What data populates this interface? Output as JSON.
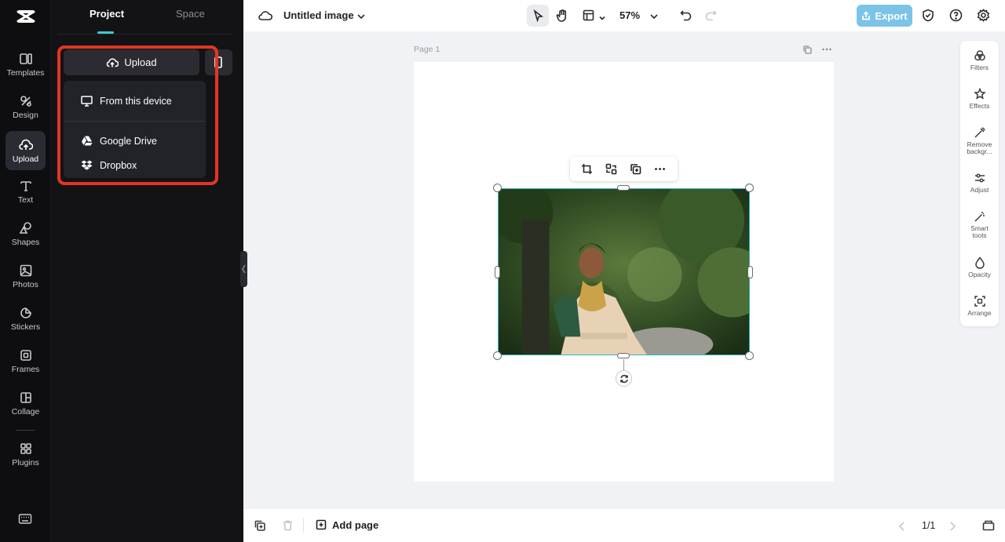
{
  "rail": {
    "items": [
      {
        "label": "Templates",
        "icon": "templates-icon"
      },
      {
        "label": "Design",
        "icon": "design-icon"
      },
      {
        "label": "Upload",
        "icon": "upload-cloud-icon",
        "active": true
      },
      {
        "label": "Text",
        "icon": "text-icon"
      },
      {
        "label": "Shapes",
        "icon": "shapes-icon"
      },
      {
        "label": "Photos",
        "icon": "photos-icon"
      },
      {
        "label": "Stickers",
        "icon": "stickers-icon"
      },
      {
        "label": "Frames",
        "icon": "frames-icon"
      },
      {
        "label": "Collage",
        "icon": "collage-icon"
      },
      {
        "label": "Plugins",
        "icon": "plugins-icon"
      }
    ]
  },
  "panel": {
    "tabs": [
      {
        "label": "Project",
        "active": true
      },
      {
        "label": "Space",
        "active": false
      }
    ],
    "upload_label": "Upload",
    "dropdown": [
      {
        "label": "From this device",
        "icon": "monitor-icon"
      },
      {
        "label": "Google Drive",
        "icon": "google-drive-icon"
      },
      {
        "label": "Dropbox",
        "icon": "dropbox-icon"
      }
    ]
  },
  "topbar": {
    "title": "Untitled image",
    "zoom": "57%",
    "export_label": "Export"
  },
  "canvas": {
    "page_label": "Page 1"
  },
  "right_rail": [
    {
      "label": "Filters",
      "icon": "filters-icon"
    },
    {
      "label": "Effects",
      "icon": "effects-icon"
    },
    {
      "label": "Remove backgr...",
      "icon": "remove-background-icon"
    },
    {
      "label": "Adjust",
      "icon": "adjust-icon"
    },
    {
      "label": "Smart tools",
      "icon": "smart-tools-icon"
    },
    {
      "label": "Opacity",
      "icon": "opacity-icon"
    },
    {
      "label": "Arrange",
      "icon": "arrange-icon"
    }
  ],
  "bottombar": {
    "add_page_label": "Add page",
    "page_count": "1/1"
  },
  "colors": {
    "accent": "#3fc7d6",
    "highlight": "#e53424",
    "export": "#7cc3e8",
    "selection": "#34b6c6"
  }
}
